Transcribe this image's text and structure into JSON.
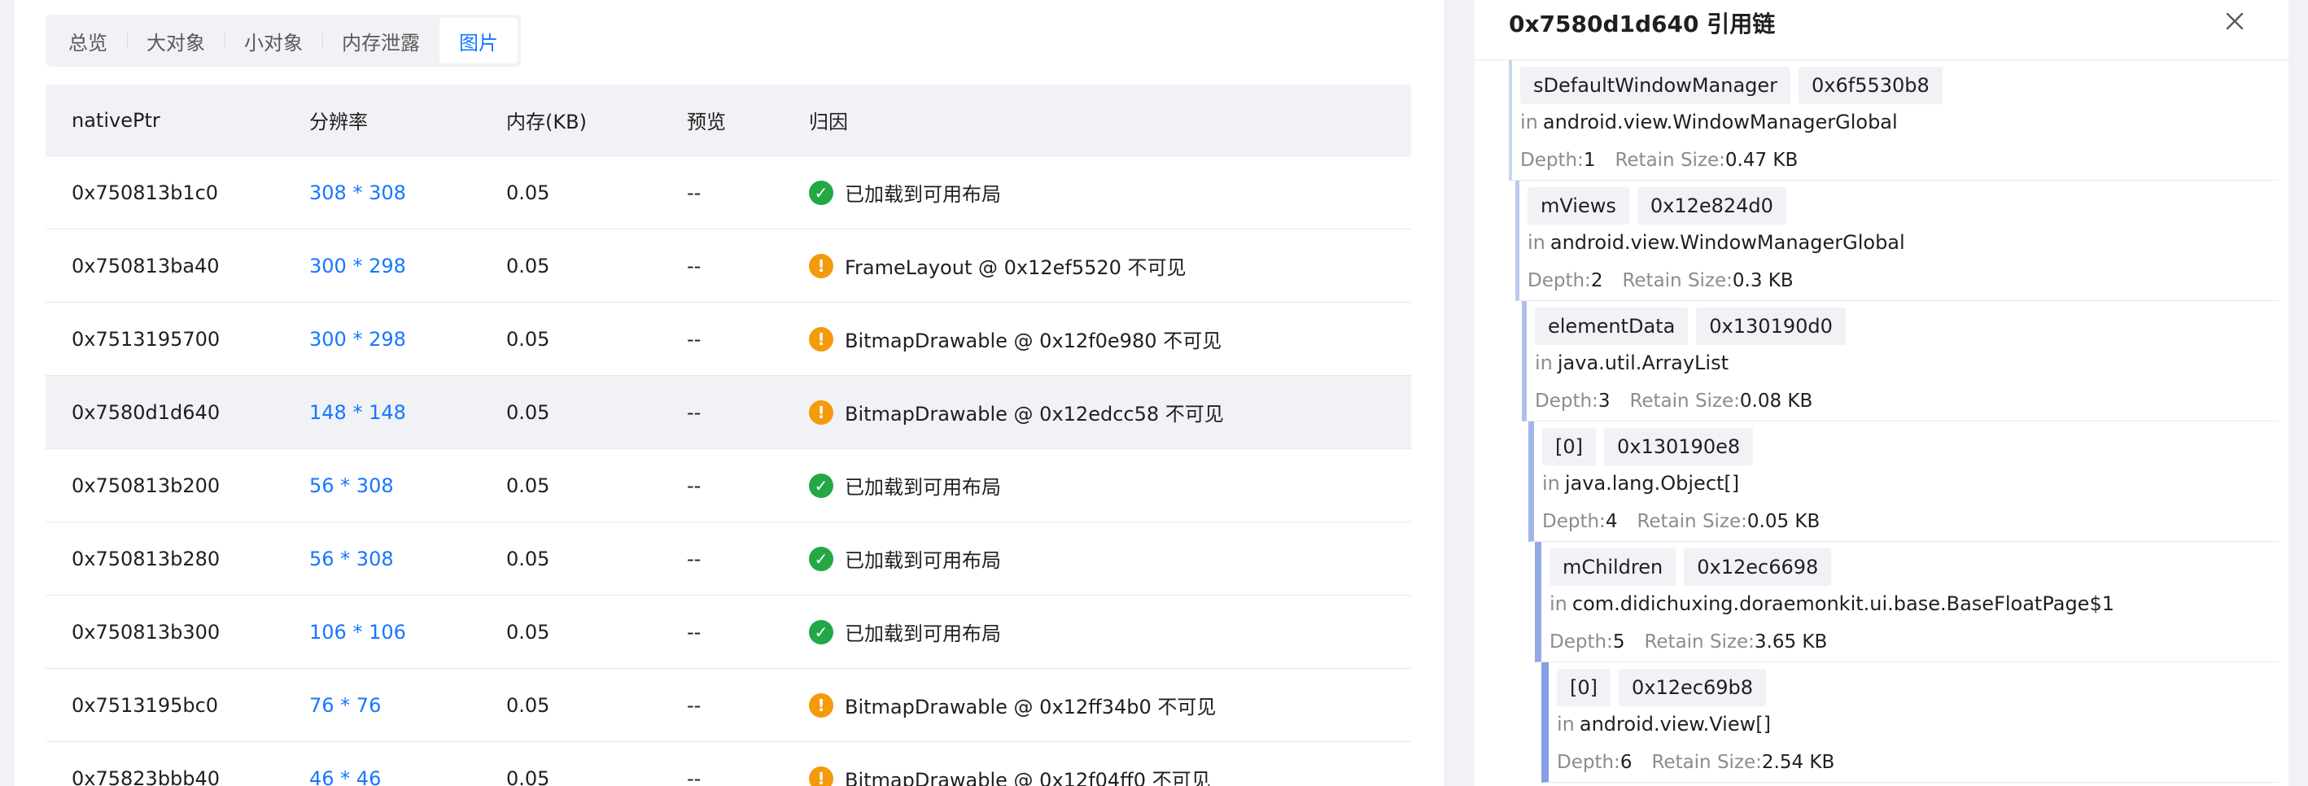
{
  "tabs": [
    {
      "label": "总览",
      "active": false
    },
    {
      "label": "大对象",
      "active": false
    },
    {
      "label": "小对象",
      "active": false
    },
    {
      "label": "内存泄露",
      "active": false
    },
    {
      "label": "图片",
      "active": true
    }
  ],
  "table": {
    "headers": [
      "nativePtr",
      "分辨率",
      "内存(KB)",
      "预览",
      "归因"
    ],
    "rows": [
      {
        "ptr": "0x750813b1c0",
        "res": "308 * 308",
        "mem": "0.05",
        "preview": "--",
        "status": "ok",
        "reason": "已加载到可用布局",
        "selected": false
      },
      {
        "ptr": "0x750813ba40",
        "res": "300 * 298",
        "mem": "0.05",
        "preview": "--",
        "status": "warn",
        "reason": "FrameLayout @ 0x12ef5520 不可见",
        "selected": false
      },
      {
        "ptr": "0x7513195700",
        "res": "300 * 298",
        "mem": "0.05",
        "preview": "--",
        "status": "warn",
        "reason": "BitmapDrawable @ 0x12f0e980 不可见",
        "selected": false
      },
      {
        "ptr": "0x7580d1d640",
        "res": "148 * 148",
        "mem": "0.05",
        "preview": "--",
        "status": "warn",
        "reason": "BitmapDrawable @ 0x12edcc58 不可见",
        "selected": true
      },
      {
        "ptr": "0x750813b200",
        "res": "56 * 308",
        "mem": "0.05",
        "preview": "--",
        "status": "ok",
        "reason": "已加载到可用布局",
        "selected": false
      },
      {
        "ptr": "0x750813b280",
        "res": "56 * 308",
        "mem": "0.05",
        "preview": "--",
        "status": "ok",
        "reason": "已加载到可用布局",
        "selected": false
      },
      {
        "ptr": "0x750813b300",
        "res": "106 * 106",
        "mem": "0.05",
        "preview": "--",
        "status": "ok",
        "reason": "已加载到可用布局",
        "selected": false
      },
      {
        "ptr": "0x7513195bc0",
        "res": "76 * 76",
        "mem": "0.05",
        "preview": "--",
        "status": "warn",
        "reason": "BitmapDrawable @ 0x12ff34b0 不可见",
        "selected": false
      },
      {
        "ptr": "0x75823bbb40",
        "res": "46 * 46",
        "mem": "0.05",
        "preview": "--",
        "status": "warn",
        "reason": "BitmapDrawable @ 0x12f04ff0 不可见",
        "selected": false
      }
    ]
  },
  "panel": {
    "title": "0x7580d1d640  引用链",
    "close_icon": "close-icon",
    "in_keyword": "in",
    "depth_label": "Depth:",
    "retain_label": "Retain Size:",
    "chain": [
      {
        "field": "sDefaultWindowManager",
        "addr": "0x6f5530b8",
        "cls": "android.view.WindowManagerGlobal",
        "depth": "1",
        "retain": "0.47 KB"
      },
      {
        "field": "mViews",
        "addr": "0x12e824d0",
        "cls": "android.view.WindowManagerGlobal",
        "depth": "2",
        "retain": "0.3 KB"
      },
      {
        "field": "elementData",
        "addr": "0x130190d0",
        "cls": "java.util.ArrayList",
        "depth": "3",
        "retain": "0.08 KB"
      },
      {
        "field": "[0]",
        "addr": "0x130190e8",
        "cls": "java.lang.Object[]",
        "depth": "4",
        "retain": "0.05 KB"
      },
      {
        "field": "mChildren",
        "addr": "0x12ec6698",
        "cls": "com.didichuxing.doraemonkit.ui.base.BaseFloatPage$1",
        "depth": "5",
        "retain": "3.65 KB"
      },
      {
        "field": "[0]",
        "addr": "0x12ec69b8",
        "cls": "android.view.View[]",
        "depth": "6",
        "retain": "2.54 KB"
      }
    ]
  },
  "colors": {
    "accent": "#1677ff",
    "ok": "#22a845",
    "warn": "#f59a0b",
    "chain_border": [
      "#c9d6f2",
      "#bccbef",
      "#aec0ec",
      "#a0b5e9",
      "#92aae6",
      "#849fe3"
    ]
  }
}
